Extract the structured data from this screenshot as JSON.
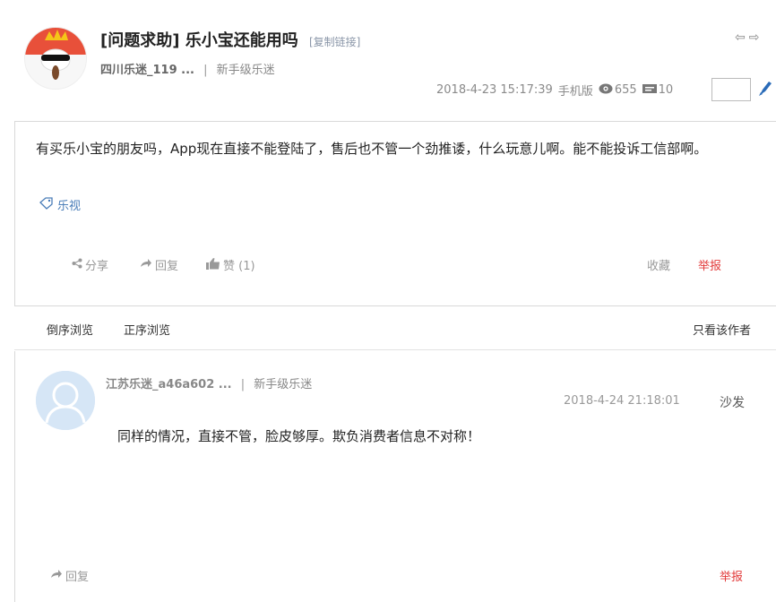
{
  "post": {
    "title": "[问题求助] 乐小宝还能用吗",
    "copy_link": "[复制链接]",
    "author": "四川乐迷_119 ...",
    "separator": "|",
    "author_level": "新手级乐迷",
    "date": "2018-4-23 15:17:39",
    "client": "手机版",
    "views": "655",
    "replies": "10",
    "body": "有买乐小宝的朋友吗，App现在直接不能登陆了，售后也不管一个劲推诿，什么玩意儿啊。能不能投诉工信部啊。",
    "tag": "乐视",
    "actions": {
      "share": "分享",
      "reply": "回复",
      "like": "赞 (1)",
      "favorite": "收藏",
      "report": "举报"
    }
  },
  "sort_bar": {
    "reverse": "倒序浏览",
    "forward": "正序浏览",
    "author_only": "只看该作者"
  },
  "reply": {
    "author": "江苏乐迷_a46a602 ...",
    "separator": "|",
    "author_level": "新手级乐迷",
    "date": "2018-4-24 21:18:01",
    "floor": "沙发",
    "body": "同样的情况，直接不管，脸皮够厚。欺负消费者信息不对称！",
    "actions": {
      "reply": "回复",
      "report": "举报"
    }
  },
  "colors": {
    "link_blue": "#4a7db8",
    "report_red": "#e23a3a",
    "avatar_red": "#e8503a",
    "avatar_placeholder": "#d6e6f6"
  },
  "icons": [
    "previous-icon",
    "next-icon",
    "eye-icon",
    "comment-icon",
    "edit-icon",
    "tag-icon",
    "share-icon",
    "reply-icon",
    "thumbs-up-icon"
  ]
}
